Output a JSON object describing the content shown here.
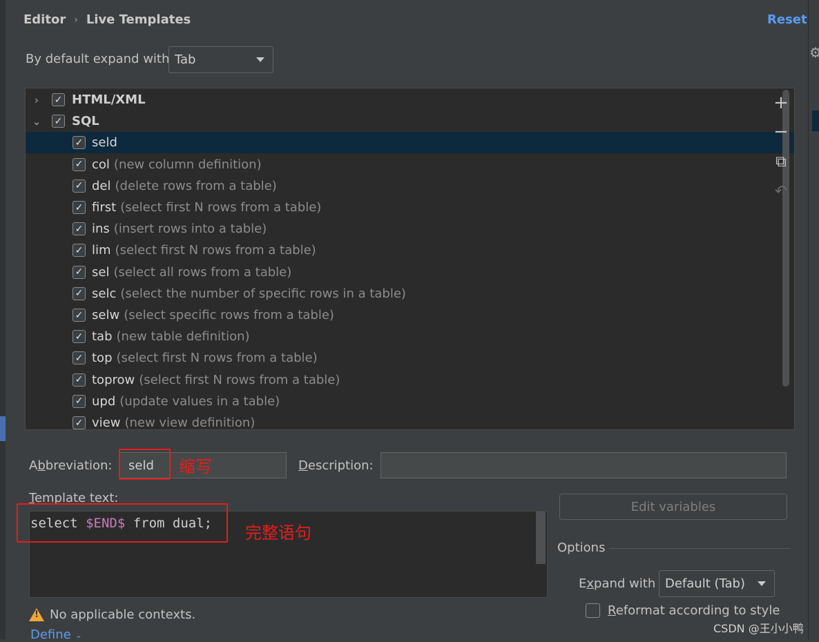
{
  "breadcrumb": {
    "section": "Editor",
    "separator": "›",
    "page": "Live Templates"
  },
  "reset_label": "Reset",
  "default_expand": {
    "label": "By default expand with",
    "value": "Tab"
  },
  "tree": {
    "groups": [
      {
        "name": "HTML/XML",
        "expanded": false,
        "checked": true
      },
      {
        "name": "SQL",
        "expanded": true,
        "checked": true
      }
    ],
    "items": [
      {
        "name": "seld",
        "desc": "",
        "checked": true,
        "selected": true
      },
      {
        "name": "col",
        "desc": "(new column definition)",
        "checked": true
      },
      {
        "name": "del",
        "desc": "(delete rows from a table)",
        "checked": true
      },
      {
        "name": "first",
        "desc": "(select first N rows from a table)",
        "checked": true
      },
      {
        "name": "ins",
        "desc": "(insert rows into a table)",
        "checked": true
      },
      {
        "name": "lim",
        "desc": "(select first N rows from a table)",
        "checked": true
      },
      {
        "name": "sel",
        "desc": "(select all rows from a table)",
        "checked": true
      },
      {
        "name": "selc",
        "desc": "(select the number of specific rows in a table)",
        "checked": true
      },
      {
        "name": "selw",
        "desc": "(select specific rows from a table)",
        "checked": true
      },
      {
        "name": "tab",
        "desc": "(new table definition)",
        "checked": true
      },
      {
        "name": "top",
        "desc": "(select first N rows from a table)",
        "checked": true
      },
      {
        "name": "toprow",
        "desc": "(select first N rows from a table)",
        "checked": true
      },
      {
        "name": "upd",
        "desc": "(update values in a table)",
        "checked": true
      },
      {
        "name": "view",
        "desc": "(new view definition)",
        "checked": true
      }
    ]
  },
  "side_buttons": {
    "add": "+",
    "remove": "−",
    "copy": "⧉",
    "restore": "↶"
  },
  "abbreviation": {
    "label_pre": "A",
    "label_mn": "b",
    "label_post": "breviation:",
    "value": "seld",
    "annotation": "缩写"
  },
  "description": {
    "label_mn": "D",
    "label_post": "escription:",
    "value": ""
  },
  "template_text": {
    "label_mn": "T",
    "label_post": "emplate text:",
    "code_pre": "select ",
    "code_var": "$END$",
    "code_post": " from dual;",
    "annotation": "完整语句"
  },
  "edit_variables_label": "Edit variables",
  "options": {
    "title": "Options",
    "expand_with": {
      "label_pre": "E",
      "label_mn": "x",
      "label_post": "pand with",
      "value": "Default (Tab)"
    },
    "reformat": {
      "label_mn": "R",
      "label_post": "eformat according to style",
      "checked": false
    }
  },
  "contexts": {
    "warning": "No applicable contexts.",
    "define_label": "Define"
  },
  "watermark": "CSDN @王小小鸭",
  "colors": {
    "background": "#3c3f41",
    "tree_background": "#2b2b2b",
    "selection": "#0d293e",
    "link": "#589df6",
    "annotation_red": "#e51d1d",
    "template_variable": "#c77dbb"
  }
}
